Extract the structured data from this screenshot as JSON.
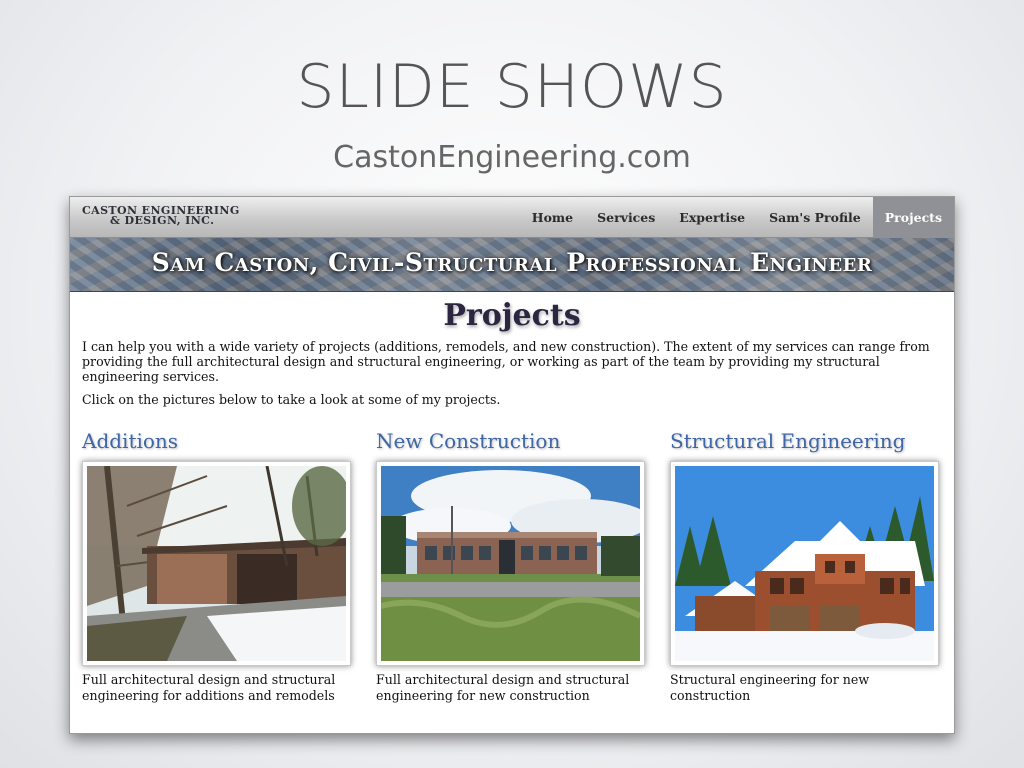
{
  "slide": {
    "title": "SLIDE SHOWS",
    "subtitle": "CastonEngineering.com"
  },
  "site": {
    "logo_line1": "CASTON ENGINEERING",
    "logo_line2": "& DESIGN, Inc.",
    "nav": [
      {
        "label": "Home",
        "active": false
      },
      {
        "label": "Services",
        "active": false
      },
      {
        "label": "Expertise",
        "active": false
      },
      {
        "label": "Sam's Profile",
        "active": false
      },
      {
        "label": "Projects",
        "active": true
      }
    ],
    "banner_title": "Sam Caston, Civil-Structural Professional Engineer"
  },
  "page": {
    "heading": "Projects",
    "intro": "I can help you with a wide variety of projects (additions, remodels, and new construction). The extent of my services can range from providing the full architectural design and structural engineering, or working as part of the team by providing my structural engineering services.",
    "instruction": "Click on the pictures below to take a look at some of my projects.",
    "projects": [
      {
        "title": "Additions",
        "caption": "Full architectural design and structural engineering for additions and remodels"
      },
      {
        "title": "New Construction",
        "caption": "Full architectural design and structural engineering for new construction"
      },
      {
        "title": "Structural Engineering",
        "caption": "Structural engineering for new construction"
      }
    ]
  },
  "colors": {
    "accent_blue": "#3f66a6",
    "nav_active_bg": "#8f9196",
    "heading_color": "#2c2640"
  }
}
